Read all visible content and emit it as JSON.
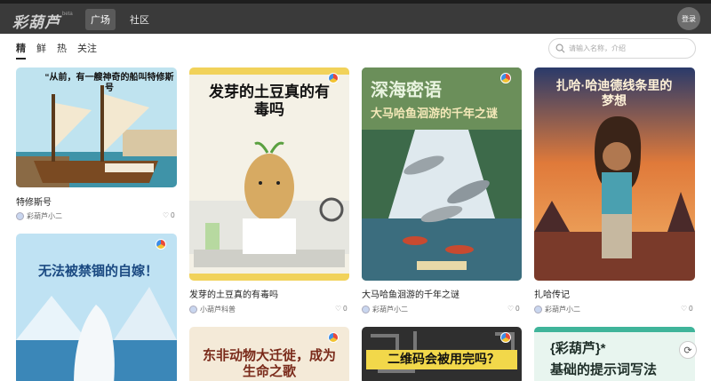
{
  "header": {
    "logo": "彩葫芦",
    "logo_beta": "beta",
    "nav": [
      {
        "label": "广场",
        "active": true
      },
      {
        "label": "社区",
        "active": false
      }
    ],
    "login_label": "登录"
  },
  "tabs": [
    {
      "label": "精",
      "active": true
    },
    {
      "label": "鲜"
    },
    {
      "label": "热"
    },
    {
      "label": "关注"
    }
  ],
  "search": {
    "placeholder": "请输入名称，介绍"
  },
  "cards": [
    {
      "title": "特修斯号",
      "overlay": "“从前，有一艘神奇的船叫特修斯号",
      "author": "彩葫芦小二",
      "likes": "0"
    },
    {
      "title": "发芽的土豆真的有毒吗",
      "overlay": "发芽的土豆真的有毒吗",
      "author": "小葫芦科普",
      "likes": "0"
    },
    {
      "title": "大马哈鱼洄游的千年之谜",
      "overlay_1": "深海密语",
      "overlay_2": "大马哈鱼洄游的千年之谜",
      "author": "彩葫芦小二",
      "likes": "0"
    },
    {
      "title": "扎哈传记",
      "overlay": "扎哈·哈迪德线条里的梦想",
      "author": "彩葫芦小二",
      "likes": "0"
    },
    {
      "overlay": "无法被禁锢的自嫁！"
    },
    {
      "overlay": "东非动物大迁徙，成为生命之歌"
    },
    {
      "overlay": "二维码会被用完吗？"
    },
    {
      "overlay_1": "{彩葫芦}*",
      "overlay_2": "基础的提示词写法"
    }
  ],
  "icons": {
    "search": "search-icon",
    "heart": "heart-icon",
    "badge": "colorful-badge-icon",
    "float": "refresh-icon"
  }
}
